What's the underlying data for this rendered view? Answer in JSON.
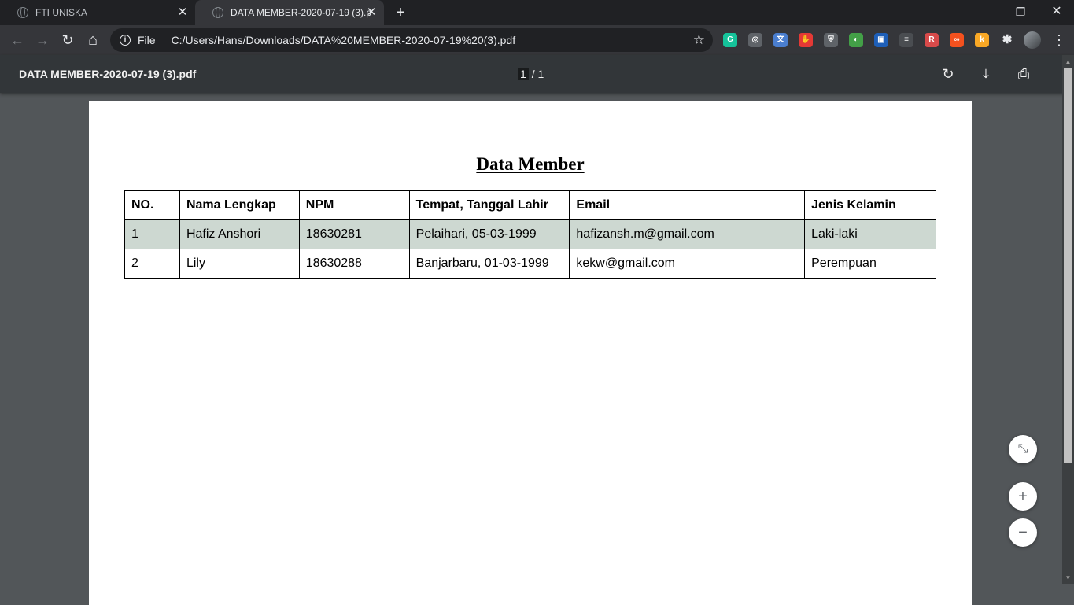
{
  "browser": {
    "tabs": [
      {
        "title": "FTI UNISKA"
      },
      {
        "title": "DATA MEMBER-2020-07-19 (3).pdf"
      }
    ],
    "new_tab_label": "+",
    "window_controls": {
      "minimize": "—",
      "restore": "❐",
      "close": "✕"
    },
    "nav": {
      "back": "←",
      "forward": "→",
      "reload": "↻",
      "home": "⌂"
    },
    "omnibox": {
      "scheme_chip": "File",
      "url": "C:/Users/Hans/Downloads/DATA%20MEMBER-2020-07-19%20(3).pdf",
      "bookmark_icon": "☆"
    },
    "extensions": [
      {
        "icon": "grammarly-icon",
        "glyph": "G",
        "color": "#15c39a"
      },
      {
        "icon": "lens-icon",
        "glyph": "◎",
        "color": "#5f6368"
      },
      {
        "icon": "google-translate-icon",
        "glyph": "文",
        "color": "#4a7ecf"
      },
      {
        "icon": "hand-stop-icon",
        "glyph": "✋",
        "color": "#e53935"
      },
      {
        "icon": "shield-icon",
        "glyph": "⛨",
        "color": "#5f6368"
      },
      {
        "icon": "color-picker-icon",
        "glyph": "◐",
        "color": "#43a047"
      },
      {
        "icon": "window-icon",
        "glyph": "▣",
        "color": "#1e5fb8"
      },
      {
        "icon": "database-icon",
        "glyph": "≡",
        "color": "#4a4d51"
      },
      {
        "icon": "reader-icon",
        "glyph": "R",
        "color": "#d84a4a"
      },
      {
        "icon": "infinity-icon",
        "glyph": "∞",
        "color": "#f4511e"
      },
      {
        "icon": "honey-icon",
        "glyph": "k",
        "color": "#f9a825"
      }
    ],
    "extensions_puzzle_icon": "puzzle-icon",
    "menu_glyph": "⋮"
  },
  "pdf_viewer": {
    "title": "DATA MEMBER-2020-07-19 (3).pdf",
    "page_current": "1",
    "page_total": "/ 1",
    "rotate_glyph": "↻",
    "download_glyph": "⤓",
    "print_glyph": "⎙",
    "zoom": {
      "fit_glyph": "⤡",
      "in_glyph": "+",
      "out_glyph": "−"
    }
  },
  "document": {
    "title": "Data Member",
    "table": {
      "headers": [
        "NO.",
        "Nama Lengkap",
        "NPM",
        "Tempat, Tanggal Lahir",
        "Email",
        "Jenis Kelamin"
      ],
      "rows": [
        [
          "1",
          "Hafiz Anshori",
          "18630281",
          "Pelaihari, 05-03-1999",
          "hafizansh.m@gmail.com",
          "Laki-laki"
        ],
        [
          "2",
          "Lily",
          "18630288",
          "Banjarbaru, 01-03-1999",
          "kekw@gmail.com",
          "Perempuan"
        ]
      ]
    }
  }
}
